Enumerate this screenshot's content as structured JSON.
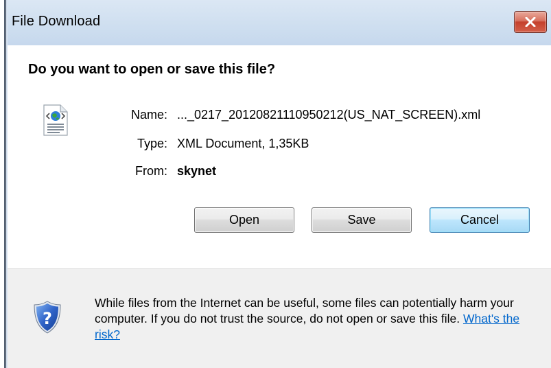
{
  "window": {
    "title": "File Download"
  },
  "dialog": {
    "heading": "Do you want to open or save this file?",
    "file": {
      "icon": "xml-document-icon",
      "name_label": "Name:",
      "name_value": "..._0217_20120821110950212(US_NAT_SCREEN).xml",
      "type_label": "Type:",
      "type_value": "XML Document, 1,35KB",
      "from_label": "From:",
      "from_value": "skynet"
    },
    "buttons": {
      "open": "Open",
      "save": "Save",
      "cancel": "Cancel"
    },
    "warning": {
      "icon": "security-shield-question-icon",
      "text": "While files from the Internet can be useful, some files can potentially harm your computer. If you do not trust the source, do not open or save this file.",
      "link": "What's the risk?"
    }
  },
  "colors": {
    "titlebar": "#cfdff0",
    "close_button": "#c4402c",
    "default_button_border": "#3c7fb1",
    "link": "#0066cc",
    "footer_background": "#f0f0f0"
  }
}
